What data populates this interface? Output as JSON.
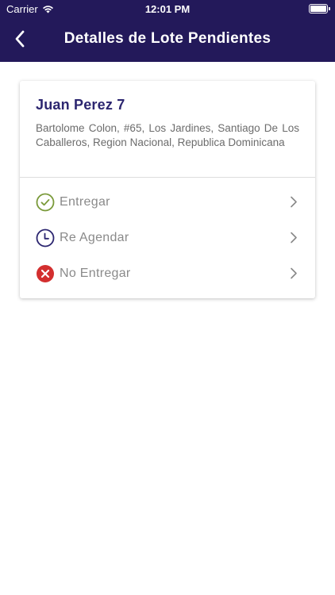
{
  "status_bar": {
    "carrier": "Carrier",
    "time": "12:01 PM",
    "wifi_icon": "wifi-icon",
    "battery_icon": "battery-icon"
  },
  "nav": {
    "title": "Detalles de Lote Pendientes",
    "back_icon": "chevron-left-icon"
  },
  "colors": {
    "header_bg": "#23195a",
    "name": "#2c2670",
    "entregar": "#7a9a3a",
    "reagendar": "#2c2670",
    "no_entregar": "#d32f2f"
  },
  "card": {
    "name": "Juan Perez 7",
    "address": "Bartolome Colon, #65, Los Jardines, Santiago De Los Caballeros, Region Nacional, Republica Dominicana",
    "actions": [
      {
        "label": "Entregar",
        "icon": "check-circle-icon"
      },
      {
        "label": "Re Agendar",
        "icon": "clock-icon"
      },
      {
        "label": "No Entregar",
        "icon": "x-circle-icon"
      }
    ]
  }
}
